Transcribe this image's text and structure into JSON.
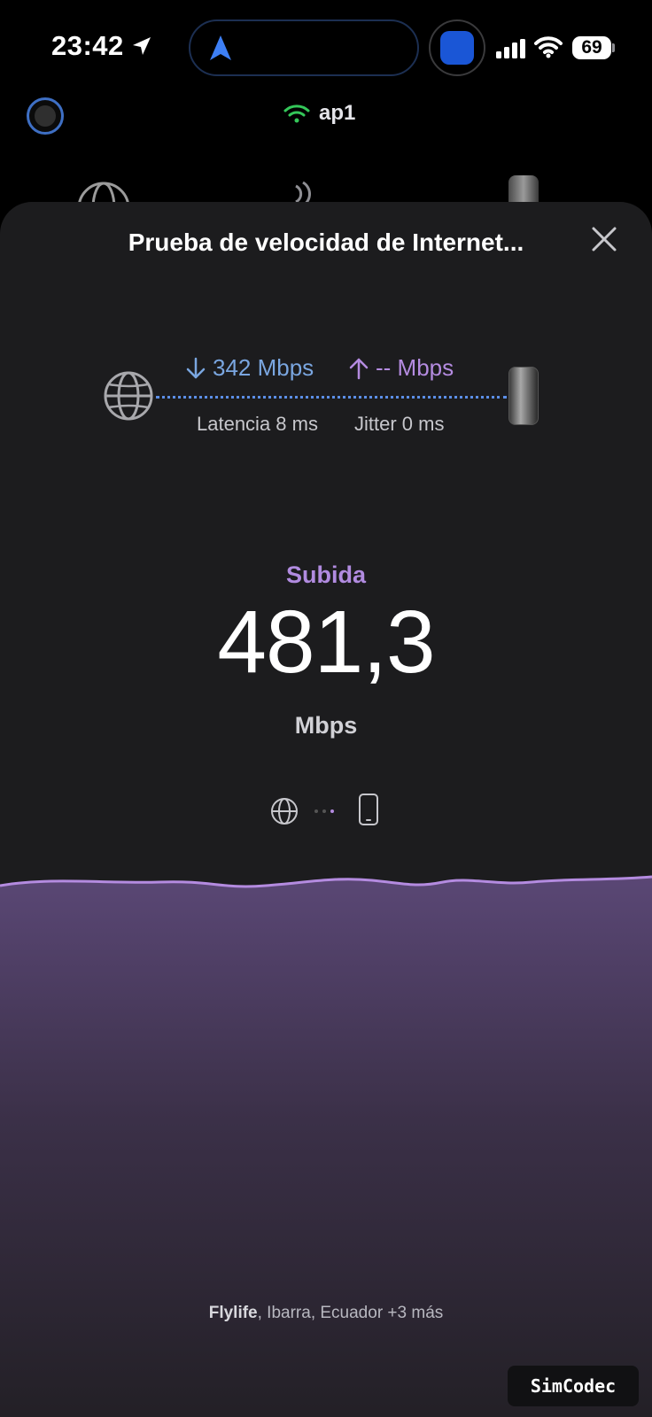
{
  "status_bar": {
    "time": "23:42",
    "battery": "69",
    "icons": [
      "location-arrow-icon",
      "navigation-icon",
      "app-icon",
      "cellular-signal-icon",
      "wifi-icon",
      "battery-icon"
    ]
  },
  "header": {
    "network_name": "ap1",
    "network_color": "#34c759"
  },
  "sheet": {
    "title": "Prueba de velocidad de Internet...",
    "download": "342 Mbps",
    "upload": "-- Mbps",
    "latency": "Latencia 8 ms",
    "jitter": "Jitter 0 ms",
    "phase": "Subida",
    "value": "481,3",
    "unit": "Mbps",
    "server_name": "Flylife",
    "server_location": ", Ibarra, Ecuador +3 más"
  },
  "watermark": "SimCodec",
  "colors": {
    "download": "#7aa6e0",
    "upload": "#b48be0",
    "sheet_bg": "#1c1c1e",
    "wave_top": "#5a4775",
    "wave_line": "#b48be0"
  }
}
